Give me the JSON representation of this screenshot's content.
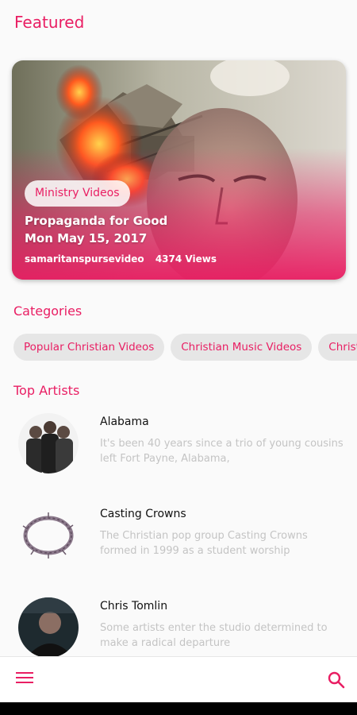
{
  "colors": {
    "accent": "#e91e63",
    "muted_text": "#c4c4c4",
    "chip_bg": "#e6e6e6"
  },
  "featured": {
    "title": "Featured",
    "card": {
      "category": "Ministry Videos",
      "title": "Propaganda for Good",
      "date": "Mon May 15, 2017",
      "channel": "samaritanspursevideo",
      "views": "4374 Views"
    }
  },
  "categories": {
    "title": "Categories",
    "items": [
      "Popular Christian Videos",
      "Christian Music Videos",
      "Christian Movies"
    ]
  },
  "artists": {
    "title": "Top Artists",
    "items": [
      {
        "name": "Alabama",
        "description": "It's been 40 years since a trio of young cousins left Fort Payne, Alabama,"
      },
      {
        "name": "Casting Crowns",
        "description": "The Christian pop group Casting Crowns formed in 1999 as a student worship"
      },
      {
        "name": "Chris Tomlin",
        "description": "Some artists enter the studio determined to make a radical departure"
      }
    ]
  },
  "bottom_bar": {
    "menu_icon": "hamburger-menu-icon",
    "search_icon": "search-icon"
  }
}
